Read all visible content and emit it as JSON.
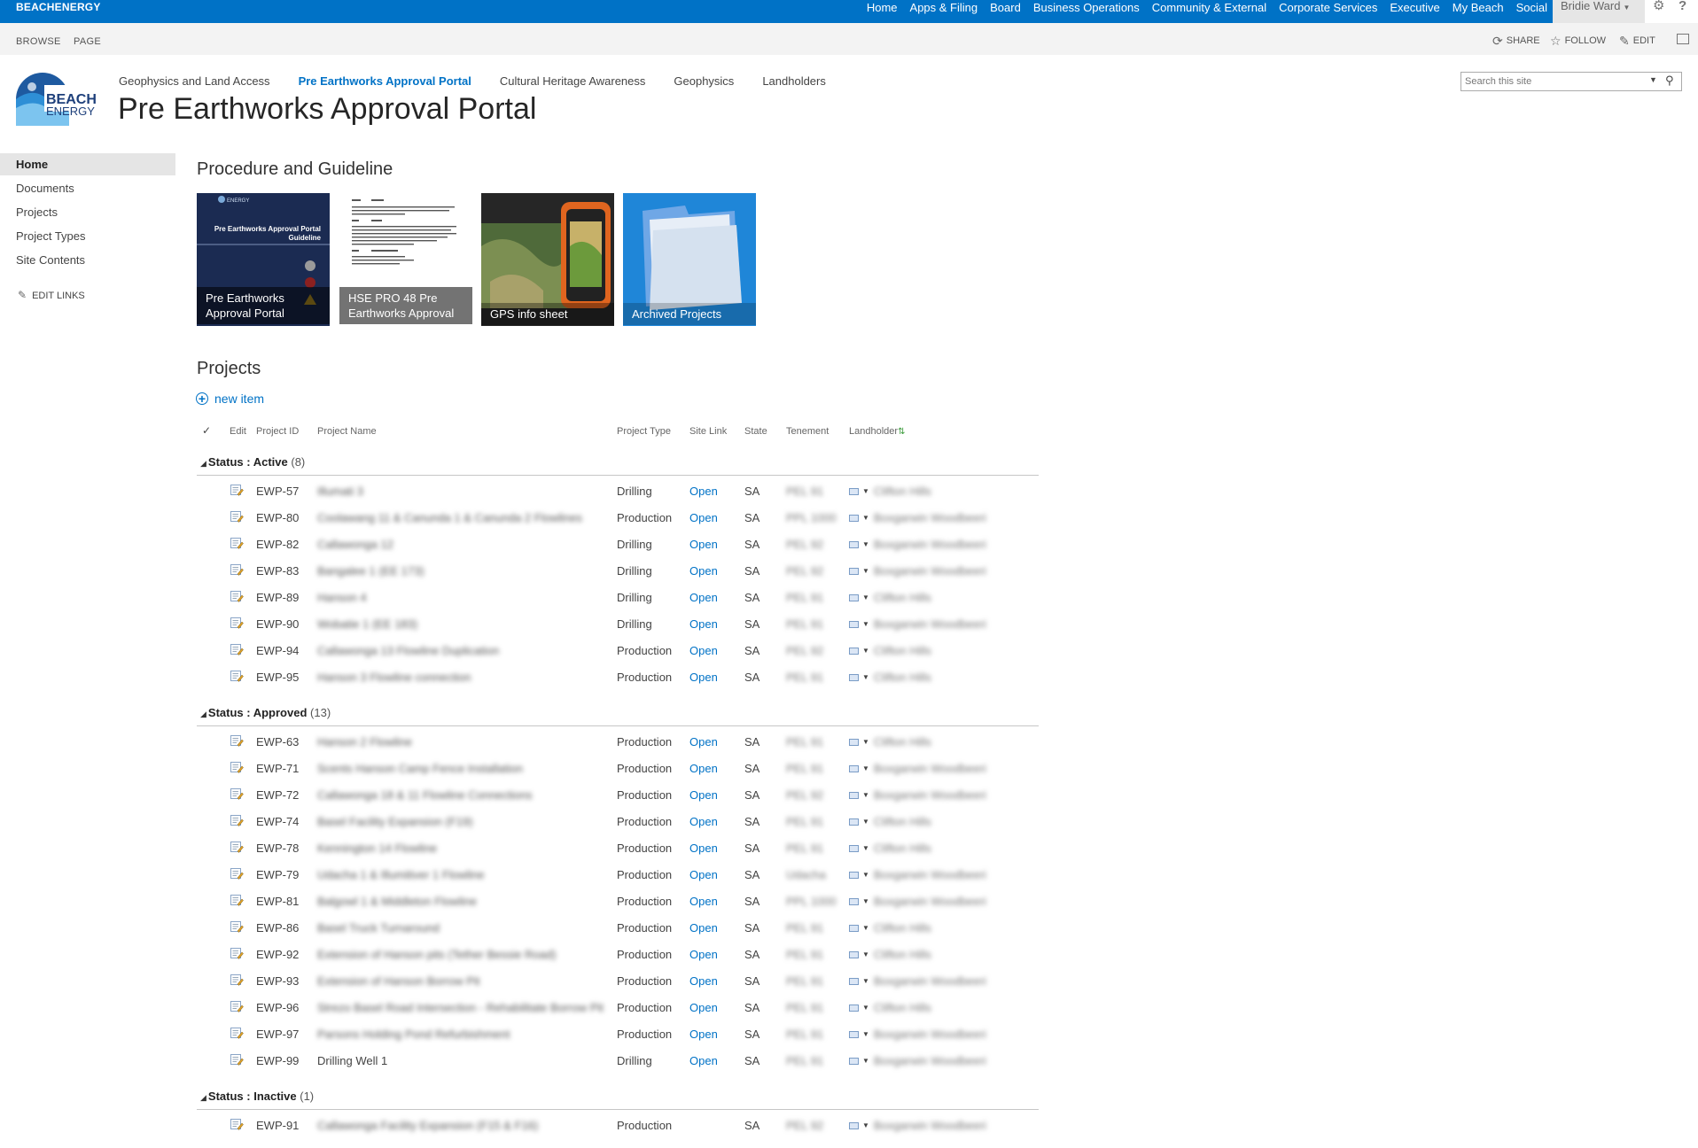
{
  "suite": {
    "brand": "BEACHENERGY",
    "nav": [
      "Home",
      "Apps & Filing",
      "Board",
      "Business Operations",
      "Community & External",
      "Corporate Services",
      "Executive",
      "My Beach",
      "Social"
    ],
    "user": "Bridie Ward"
  },
  "ribbon": {
    "tabs": [
      "BROWSE",
      "PAGE"
    ],
    "share": "SHARE",
    "follow": "FOLLOW",
    "edit": "EDIT"
  },
  "header": {
    "logo_text_1": "BEACH",
    "logo_text_2": "ENERGY",
    "top_nav": [
      {
        "label": "Geophysics and Land Access"
      },
      {
        "label": "Pre Earthworks Approval Portal"
      },
      {
        "label": "Cultural Heritage Awareness"
      },
      {
        "label": "Geophysics"
      },
      {
        "label": "Landholders"
      }
    ],
    "title": "Pre Earthworks Approval Portal",
    "search_placeholder": "Search this site"
  },
  "left_nav": {
    "items": [
      "Home",
      "Documents",
      "Projects",
      "Project Types",
      "Site Contents"
    ],
    "edit_links": "EDIT LINKS"
  },
  "procedure": {
    "title": "Procedure and Guideline",
    "tiles": [
      {
        "caption": "Pre Earthworks Approval Portal",
        "cover_brand": "ENERGY",
        "cover_title": "Pre Earthworks Approval Portal Guideline"
      },
      {
        "caption": "HSE PRO 48 Pre Earthworks Approval"
      },
      {
        "caption": "GPS info sheet"
      },
      {
        "caption": "Archived Projects"
      }
    ]
  },
  "projects": {
    "title": "Projects",
    "new_item": "new item",
    "columns": {
      "check": "✓",
      "edit": "Edit",
      "id": "Project ID",
      "name": "Project Name",
      "type": "Project Type",
      "link": "Site Link",
      "state": "State",
      "tenement": "Tenement",
      "landholder": "Landholder"
    },
    "groups": [
      {
        "label": "Status : Active",
        "count": "(8)",
        "rows": [
          {
            "id": "EWP-57",
            "name": "Illumati 3",
            "type": "Drilling",
            "link": "Open",
            "state": "SA",
            "tenement": "PEL 91",
            "landholder": "Clifton Hills"
          },
          {
            "id": "EWP-80",
            "name": "Coolawang 11 & Canunda 1 & Canunda 2 Flowlines",
            "type": "Production",
            "link": "Open",
            "state": "SA",
            "tenement": "PPL 1000",
            "landholder": "Boxgarwin Woodbeeri"
          },
          {
            "id": "EWP-82",
            "name": "Callawonga 12",
            "type": "Drilling",
            "link": "Open",
            "state": "SA",
            "tenement": "PEL 92",
            "landholder": "Boxgarwin Woodbeeri"
          },
          {
            "id": "EWP-83",
            "name": "Bangalee 1 (EE 173)",
            "type": "Drilling",
            "link": "Open",
            "state": "SA",
            "tenement": "PEL 92",
            "landholder": "Boxgarwin Woodbeeri"
          },
          {
            "id": "EWP-89",
            "name": "Hanson 4",
            "type": "Drilling",
            "link": "Open",
            "state": "SA",
            "tenement": "PEL 91",
            "landholder": "Clifton Hills"
          },
          {
            "id": "EWP-90",
            "name": "Wobatie 1 (EE 183)",
            "type": "Drilling",
            "link": "Open",
            "state": "SA",
            "tenement": "PEL 91",
            "landholder": "Boxgarwin Woodbeeri"
          },
          {
            "id": "EWP-94",
            "name": "Callawonga 13 Flowline Duplication",
            "type": "Production",
            "link": "Open",
            "state": "SA",
            "tenement": "PEL 92",
            "landholder": "Clifton Hills"
          },
          {
            "id": "EWP-95",
            "name": "Hanson 3 Flowline connection",
            "type": "Production",
            "link": "Open",
            "state": "SA",
            "tenement": "PEL 91",
            "landholder": "Clifton Hills"
          }
        ]
      },
      {
        "label": "Status : Approved",
        "count": "(13)",
        "rows": [
          {
            "id": "EWP-63",
            "name": "Hanson 2 Flowline",
            "type": "Production",
            "link": "Open",
            "state": "SA",
            "tenement": "PEL 91",
            "landholder": "Clifton Hills"
          },
          {
            "id": "EWP-71",
            "name": "Scents Hanson Camp Fence Installation",
            "type": "Production",
            "link": "Open",
            "state": "SA",
            "tenement": "PEL 91",
            "landholder": "Boxgarwin Woodbeeri"
          },
          {
            "id": "EWP-72",
            "name": "Callawonga 18 & 11 Flowline Connections",
            "type": "Production",
            "link": "Open",
            "state": "SA",
            "tenement": "PEL 92",
            "landholder": "Boxgarwin Woodbeeri"
          },
          {
            "id": "EWP-74",
            "name": "Basel Facility Expansion (F19)",
            "type": "Production",
            "link": "Open",
            "state": "SA",
            "tenement": "PEL 91",
            "landholder": "Clifton Hills"
          },
          {
            "id": "EWP-78",
            "name": "Kennington 14 Flowline",
            "type": "Production",
            "link": "Open",
            "state": "SA",
            "tenement": "PEL 91",
            "landholder": "Clifton Hills"
          },
          {
            "id": "EWP-79",
            "name": "Udacha 1 & Illumitiver 1 Flowline",
            "type": "Production",
            "link": "Open",
            "state": "SA",
            "tenement": "Udacha",
            "landholder": "Boxgarwin Woodbeeri"
          },
          {
            "id": "EWP-81",
            "name": "Balgowl 1 & Middleton Flowline",
            "type": "Production",
            "link": "Open",
            "state": "SA",
            "tenement": "PPL 1000",
            "landholder": "Boxgarwin Woodbeeri"
          },
          {
            "id": "EWP-86",
            "name": "Basel Truck Turnaround",
            "type": "Production",
            "link": "Open",
            "state": "SA",
            "tenement": "PEL 91",
            "landholder": "Clifton Hills"
          },
          {
            "id": "EWP-92",
            "name": "Extension of Hanson pits (Tether Bessie Road)",
            "type": "Production",
            "link": "Open",
            "state": "SA",
            "tenement": "PEL 91",
            "landholder": "Clifton Hills"
          },
          {
            "id": "EWP-93",
            "name": "Extension of Hanson Borrow Pit",
            "type": "Production",
            "link": "Open",
            "state": "SA",
            "tenement": "PEL 91",
            "landholder": "Boxgarwin Woodbeeri"
          },
          {
            "id": "EWP-96",
            "name": "Strezo Basel Road Intersection - Rehabilitate Borrow Pit",
            "type": "Production",
            "link": "Open",
            "state": "SA",
            "tenement": "PEL 91",
            "landholder": "Clifton Hills"
          },
          {
            "id": "EWP-97",
            "name": "Parsons Holding Pond Refurbishment",
            "type": "Production",
            "link": "Open",
            "state": "SA",
            "tenement": "PEL 91",
            "landholder": "Boxgarwin Woodbeeri"
          },
          {
            "id": "EWP-99",
            "name": "Drilling Well 1",
            "type": "Drilling",
            "link": "Open",
            "state": "SA",
            "tenement": "PEL 91",
            "landholder": "Boxgarwin Woodbeeri"
          }
        ]
      },
      {
        "label": "Status : Inactive",
        "count": "(1)",
        "rows": [
          {
            "id": "EWP-91",
            "name": "Callawonga Facility Expansion (F15 & F16)",
            "type": "Production",
            "link": "",
            "state": "SA",
            "tenement": "PEL 92",
            "landholder": "Boxgarwin Woodbeeri"
          }
        ]
      }
    ]
  },
  "icons": {
    "sync": "sync-icon",
    "star": "star-icon",
    "pencil": "pencil-icon",
    "gear": "gear-icon",
    "help": "help-icon",
    "search": "search-icon",
    "edit_row": "edit-document-icon",
    "presence": "presence-card-icon"
  },
  "colors": {
    "suite_blue": "#0072c6",
    "link_blue": "#0072c6"
  }
}
